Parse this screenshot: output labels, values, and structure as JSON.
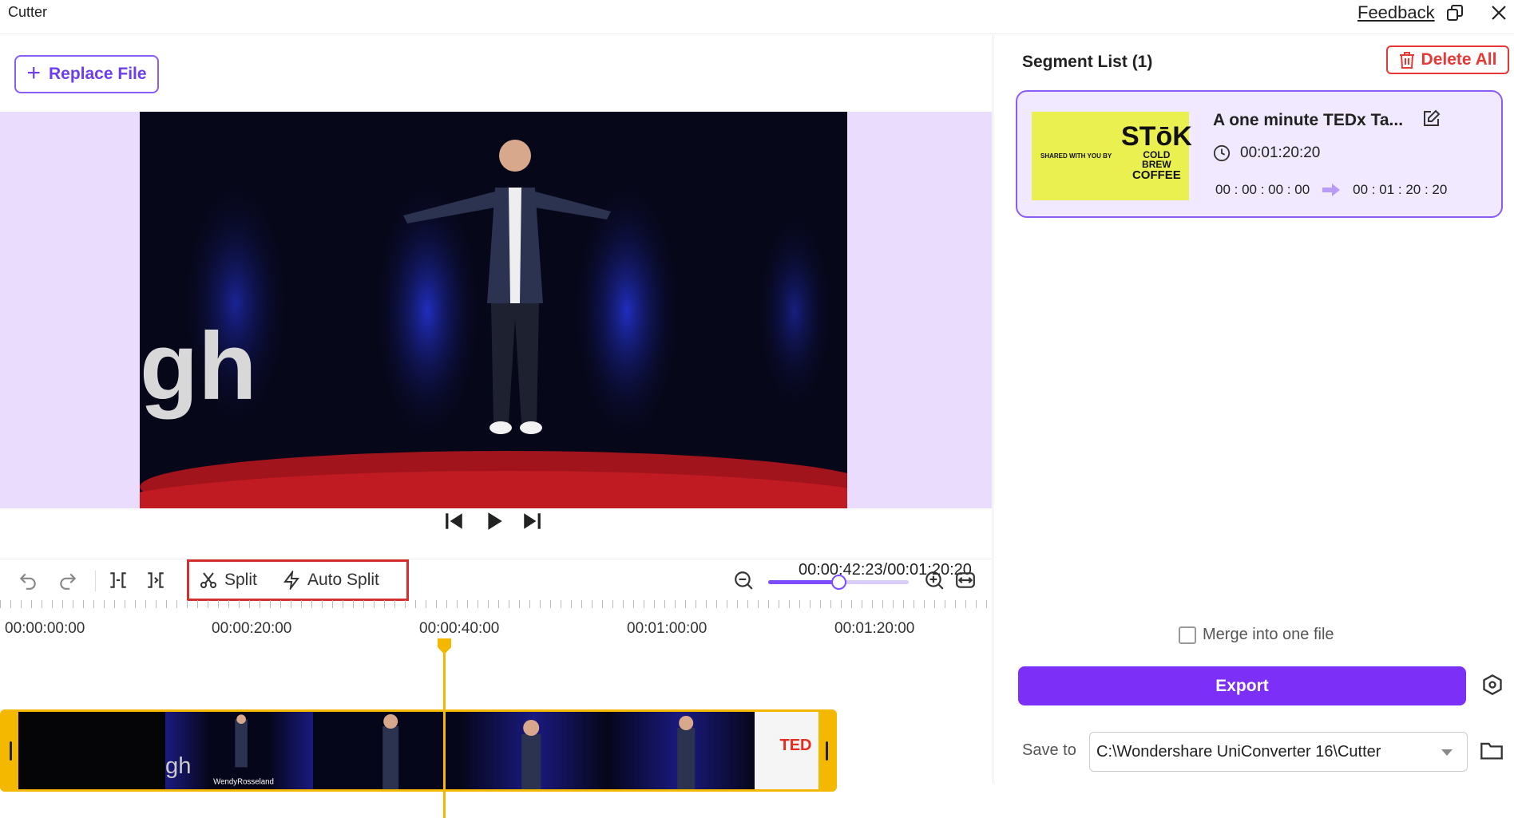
{
  "window": {
    "title": "Cutter",
    "feedback_label": "Feedback",
    "icons": [
      "restore-window-icon",
      "close-icon"
    ]
  },
  "editor": {
    "replace_file_label": "Replace File",
    "video_text": "gh",
    "timecode": "00:00:42:23/00:01:20:20",
    "toolbar": {
      "split_label": "Split",
      "auto_split_label": "Auto Split",
      "zoom_level": 0.5
    },
    "ruler_labels": [
      "00:00:00:00",
      "00:00:20:00",
      "00:00:40:00",
      "00:01:00:00",
      "00:01:20:00"
    ],
    "playhead_position": "00:00:42:23",
    "filmstrip_captions": [
      "WendyRosseland",
      "TED"
    ]
  },
  "segments": {
    "title": "Segment List (1)",
    "delete_all_label": "Delete All",
    "items": [
      {
        "name": "A one minute TEDx Ta...",
        "duration": "00:01:20:20",
        "start": "00 : 00 : 00 : 00",
        "end": "00 : 01 : 20 : 20",
        "thumb_caption": "SHARED WITH YOU BY",
        "thumb_brand": "STōK",
        "thumb_sub1": "COLD",
        "thumb_sub2": "BREW",
        "thumb_sub3": "COFFEE"
      }
    ]
  },
  "output": {
    "merge_label": "Merge into one file",
    "merge_checked": false,
    "export_label": "Export",
    "save_to_label": "Save to",
    "save_path": "C:\\Wondershare UniConverter 16\\Cutter"
  },
  "colors": {
    "accent": "#7b2ff7",
    "preview_bg": "#e9dcfd",
    "track": "#f5b800",
    "danger": "#e53935"
  }
}
